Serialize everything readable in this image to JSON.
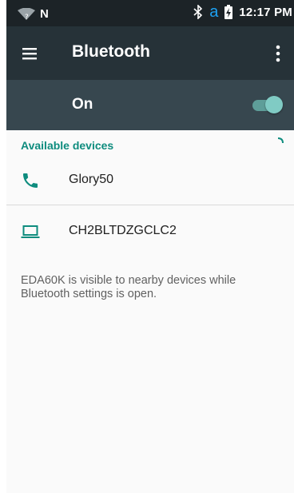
{
  "status_bar": {
    "network_letter": "N",
    "wifi_unknown": "?",
    "app_letter": "a",
    "time": "12:17 PM"
  },
  "toolbar": {
    "title": "Bluetooth",
    "menu_icon": "hamburger-menu-icon",
    "overflow_icon": "more-vert-icon"
  },
  "switch": {
    "label": "On",
    "checked": true,
    "accent": "#80cbc4"
  },
  "available": {
    "header": "Available devices",
    "devices": [
      {
        "name": "Glory50",
        "icon": "phone-icon"
      },
      {
        "name": "CH2BLTDZGCLC2",
        "icon": "laptop-icon"
      }
    ]
  },
  "footer": {
    "visibility_text": "EDA60K is visible to nearby devices while Bluetooth settings is open."
  },
  "colors": {
    "status_bar": "#1c2327",
    "toolbar": "#263238",
    "switch_bar": "#37474f",
    "accent": "#0e8c7e"
  }
}
